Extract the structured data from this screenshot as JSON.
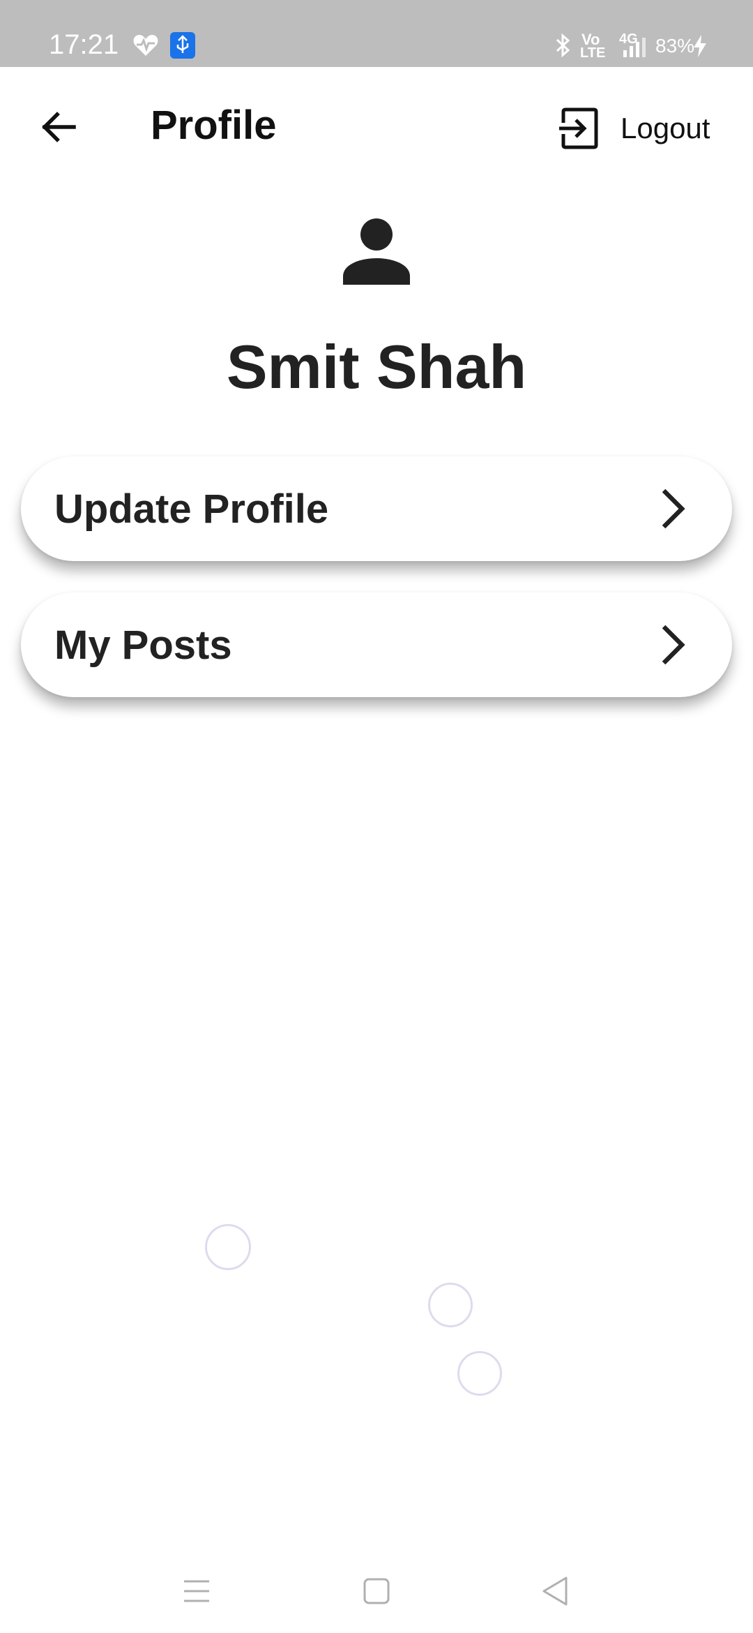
{
  "status_bar": {
    "time": "17:21",
    "volte_top": "Vo",
    "volte_bottom": "LTE",
    "network": "4G",
    "battery": "83%",
    "icons": [
      "heart-rate-icon",
      "usb-debug-icon",
      "bluetooth-icon",
      "volte-icon",
      "signal-icon",
      "charging-icon"
    ]
  },
  "app_bar": {
    "title": "Profile",
    "logout_label": "Logout",
    "icons": [
      "back-arrow-icon",
      "logout-icon"
    ]
  },
  "profile": {
    "avatar_icon": "person-icon",
    "name": "Smit Shah"
  },
  "menu": {
    "items": [
      {
        "label": "Update Profile",
        "icon": "chevron-right-icon"
      },
      {
        "label": "My Posts",
        "icon": "chevron-right-icon"
      }
    ]
  },
  "nav_bar": {
    "icons": [
      "recents-icon",
      "home-icon",
      "back-icon"
    ]
  },
  "colors": {
    "status_bar": "#bdbdbd",
    "background": "#ffffff",
    "text": "#222222",
    "usb_badge": "#1a73e8"
  }
}
